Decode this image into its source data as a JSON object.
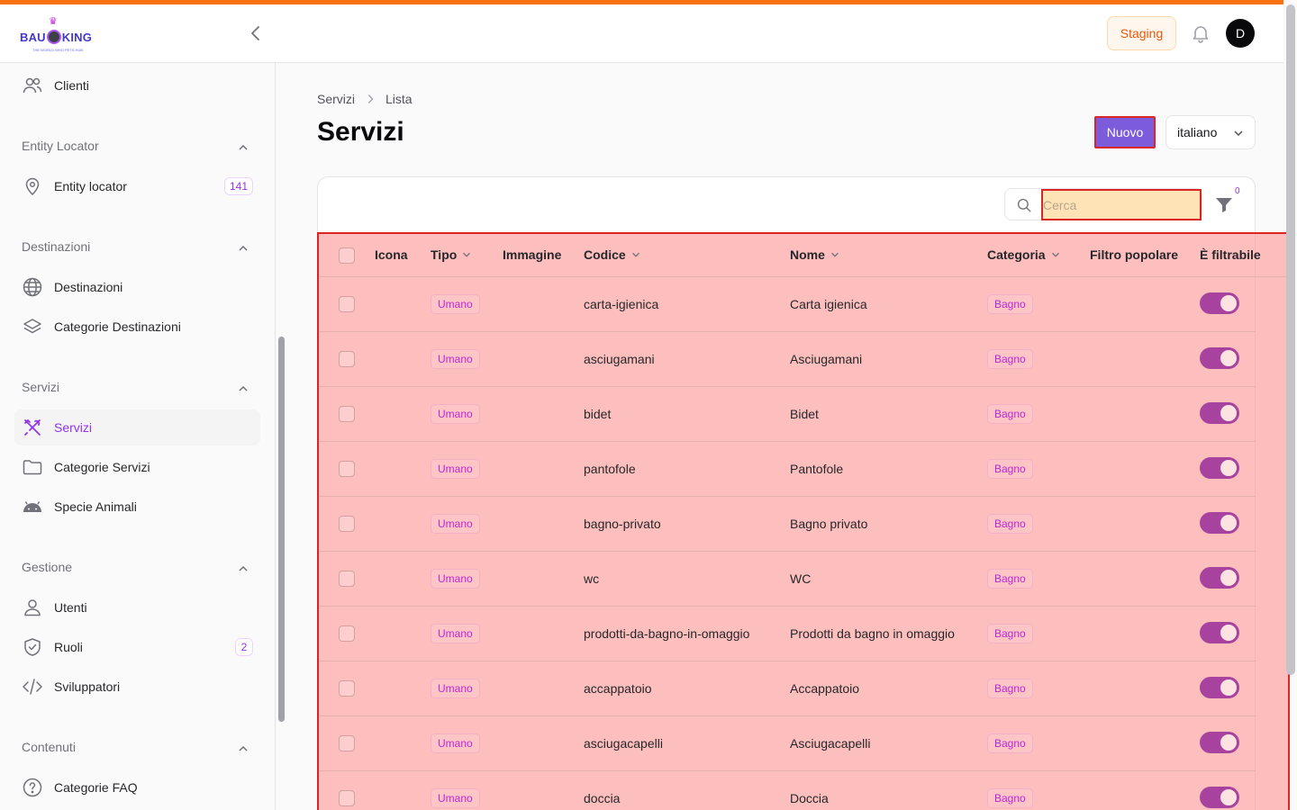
{
  "app": {
    "logo_text_left": "BAU",
    "logo_text_right": "KING",
    "logo_tagline": "THE WORLD WHO PETS HUB",
    "environment": "Staging",
    "avatar_initial": "D"
  },
  "sidebar": {
    "top_item": {
      "label": "Clienti",
      "icon": "users-icon"
    },
    "groups": [
      {
        "title": "Entity Locator",
        "items": [
          {
            "label": "Entity locator",
            "icon": "map-pin-icon",
            "count": "141"
          }
        ]
      },
      {
        "title": "Destinazioni",
        "items": [
          {
            "label": "Destinazioni",
            "icon": "globe-icon"
          },
          {
            "label": "Categorie Destinazioni",
            "icon": "layers-icon"
          }
        ]
      },
      {
        "title": "Servizi",
        "items": [
          {
            "label": "Servizi",
            "icon": "tools-icon",
            "active": true
          },
          {
            "label": "Categorie Servizi",
            "icon": "folder-icon"
          },
          {
            "label": "Specie Animali",
            "icon": "android-icon"
          }
        ]
      },
      {
        "title": "Gestione",
        "items": [
          {
            "label": "Utenti",
            "icon": "user-icon"
          },
          {
            "label": "Ruoli",
            "icon": "shield-icon",
            "count": "2"
          },
          {
            "label": "Sviluppatori",
            "icon": "code-icon"
          }
        ]
      },
      {
        "title": "Contenuti",
        "items": [
          {
            "label": "Categorie FAQ",
            "icon": "help-circle-icon"
          }
        ]
      }
    ]
  },
  "breadcrumb": {
    "root": "Servizi",
    "current": "Lista"
  },
  "page": {
    "title": "Servizi",
    "new_button": "Nuovo",
    "language": "italiano"
  },
  "search": {
    "placeholder": "Cerca"
  },
  "filters": {
    "active_count": "0"
  },
  "table": {
    "columns": [
      "Icona",
      "Tipo",
      "Immagine",
      "Codice",
      "Nome",
      "Categoria",
      "Filtro popolare",
      "È filtrabile"
    ],
    "rows": [
      {
        "tipo": "Umano",
        "codice": "carta-igienica",
        "nome": "Carta igienica",
        "categoria": "Bagno",
        "filtrabile": true
      },
      {
        "tipo": "Umano",
        "codice": "asciugamani",
        "nome": "Asciugamani",
        "categoria": "Bagno",
        "filtrabile": true
      },
      {
        "tipo": "Umano",
        "codice": "bidet",
        "nome": "Bidet",
        "categoria": "Bagno",
        "filtrabile": true
      },
      {
        "tipo": "Umano",
        "codice": "pantofole",
        "nome": "Pantofole",
        "categoria": "Bagno",
        "filtrabile": true
      },
      {
        "tipo": "Umano",
        "codice": "bagno-privato",
        "nome": "Bagno privato",
        "categoria": "Bagno",
        "filtrabile": true
      },
      {
        "tipo": "Umano",
        "codice": "wc",
        "nome": "WC",
        "categoria": "Bagno",
        "filtrabile": true
      },
      {
        "tipo": "Umano",
        "codice": "prodotti-da-bagno-in-omaggio",
        "nome": "Prodotti da bagno in omaggio",
        "categoria": "Bagno",
        "filtrabile": true
      },
      {
        "tipo": "Umano",
        "codice": "accappatoio",
        "nome": "Accappatoio",
        "categoria": "Bagno",
        "filtrabile": true
      },
      {
        "tipo": "Umano",
        "codice": "asciugacapelli",
        "nome": "Asciugacapelli",
        "categoria": "Bagno",
        "filtrabile": true
      },
      {
        "tipo": "Umano",
        "codice": "doccia",
        "nome": "Doccia",
        "categoria": "Bagno",
        "filtrabile": true
      }
    ]
  },
  "colors": {
    "accent": "#f97316",
    "brand": "#7c5cdb",
    "active_nav": "#9333ea"
  }
}
